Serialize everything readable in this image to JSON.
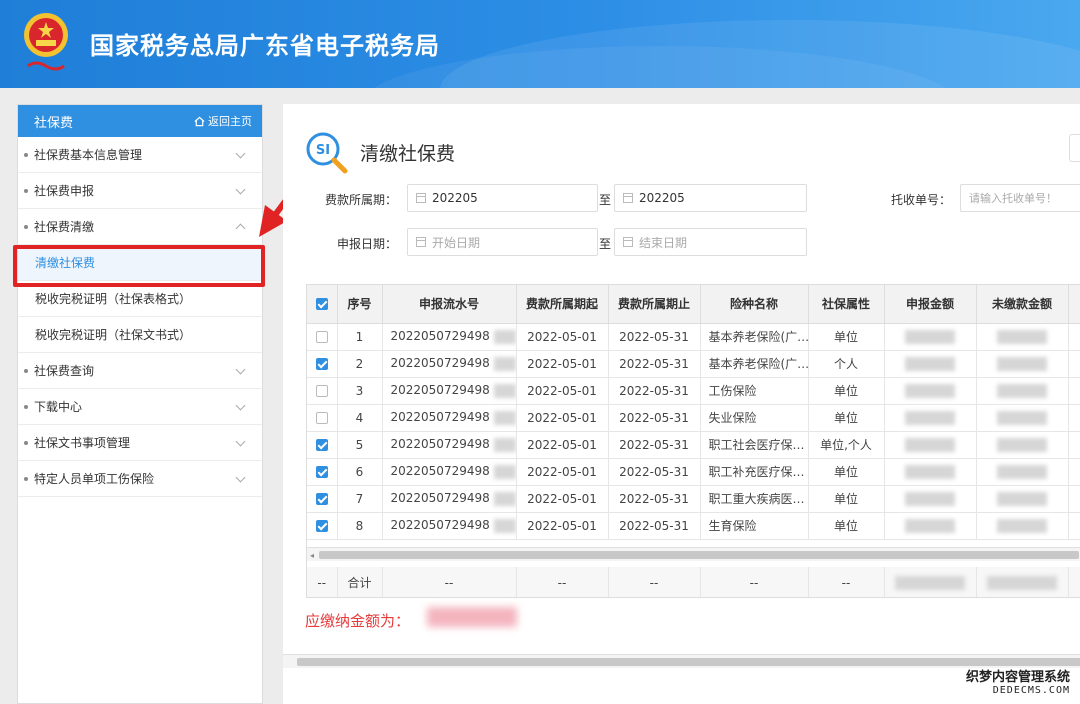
{
  "header": {
    "site_title": "国家税务总局广东省电子税务局"
  },
  "sidebar": {
    "title": "社保费",
    "home_link": "返回主页",
    "items": [
      {
        "label": "社保费基本信息管理",
        "expanded": false
      },
      {
        "label": "社保费申报",
        "expanded": false
      },
      {
        "label": "社保费清缴",
        "expanded": true
      },
      {
        "label": "清缴社保费",
        "sub": true,
        "active": true
      },
      {
        "label": "税收完税证明（社保表格式）",
        "sub": true
      },
      {
        "label": "税收完税证明（社保文书式）",
        "sub": true
      },
      {
        "label": "社保费查询",
        "expanded": false
      },
      {
        "label": "下载中心",
        "expanded": false
      },
      {
        "label": "社保文书事项管理",
        "expanded": false
      },
      {
        "label": "特定人员单项工伤保险",
        "expanded": false
      }
    ]
  },
  "main": {
    "title": "清缴社保费",
    "filters": {
      "period_label": "费款所属期：",
      "period_from": "202205",
      "to": "至",
      "period_to": "202205",
      "trust_label": "托收单号：",
      "trust_placeholder": "请输入托收单号！",
      "date_label": "申报日期：",
      "date_from_placeholder": "开始日期",
      "date_to_placeholder": "结束日期"
    },
    "table": {
      "headers": [
        "序号",
        "申报流水号",
        "费款所属期起",
        "费款所属期止",
        "险种名称",
        "社保属性",
        "申报金额",
        "未缴款金额"
      ],
      "rows": [
        {
          "checked": false,
          "no": "1",
          "serial": "2022050729498",
          "start": "2022-05-01",
          "end": "2022-05-31",
          "type": "基本养老保险(广…",
          "attr": "单位"
        },
        {
          "checked": true,
          "no": "2",
          "serial": "2022050729498",
          "start": "2022-05-01",
          "end": "2022-05-31",
          "type": "基本养老保险(广…",
          "attr": "个人"
        },
        {
          "checked": false,
          "no": "3",
          "serial": "2022050729498",
          "start": "2022-05-01",
          "end": "2022-05-31",
          "type": "工伤保险",
          "attr": "单位"
        },
        {
          "checked": false,
          "no": "4",
          "serial": "2022050729498",
          "start": "2022-05-01",
          "end": "2022-05-31",
          "type": "失业保险",
          "attr": "单位"
        },
        {
          "checked": true,
          "no": "5",
          "serial": "2022050729498",
          "start": "2022-05-01",
          "end": "2022-05-31",
          "type": "职工社会医疗保…",
          "attr": "单位,个人"
        },
        {
          "checked": true,
          "no": "6",
          "serial": "2022050729498",
          "start": "2022-05-01",
          "end": "2022-05-31",
          "type": "职工补充医疗保…",
          "attr": "单位"
        },
        {
          "checked": true,
          "no": "7",
          "serial": "2022050729498",
          "start": "2022-05-01",
          "end": "2022-05-31",
          "type": "职工重大疾病医…",
          "attr": "单位"
        },
        {
          "checked": true,
          "no": "8",
          "serial": "2022050729498",
          "start": "2022-05-01",
          "end": "2022-05-31",
          "type": "生育保险",
          "attr": "单位"
        }
      ],
      "sum_label": "合计",
      "dash": "--"
    },
    "due_label": "应缴纳金额为："
  },
  "watermark": {
    "line1": "织梦内容管理系统",
    "line2": "DEDECMS.COM"
  },
  "colors": {
    "header_blue": "#2d8ee6",
    "accent": "#2f8fe0",
    "highlight_red": "#e02424",
    "due_red": "#e53c3c"
  }
}
